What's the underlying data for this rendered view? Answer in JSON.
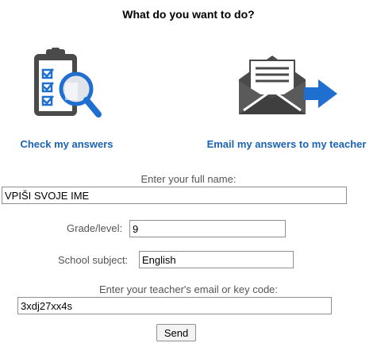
{
  "header": {
    "title": "What do you want to do?"
  },
  "options": {
    "check": {
      "label": "Check my answers",
      "icon": "clipboard-magnifier-icon"
    },
    "email": {
      "label": "Email my answers to my teacher",
      "icon": "envelope-send-icon"
    }
  },
  "colors": {
    "accent": "#1a63b5",
    "icon_gray": "#4a4a4a",
    "icon_blue": "#1f6fd0"
  },
  "form": {
    "name": {
      "label": "Enter your full name:",
      "value": "VPIŠI SVOJE IME"
    },
    "grade": {
      "label": "Grade/level:",
      "value": "9"
    },
    "subject": {
      "label": "School subject:",
      "value": "English"
    },
    "teacher": {
      "label": "Enter your teacher's email or key code:",
      "value": "3xdj27xx4s"
    },
    "send_label": "Send"
  }
}
